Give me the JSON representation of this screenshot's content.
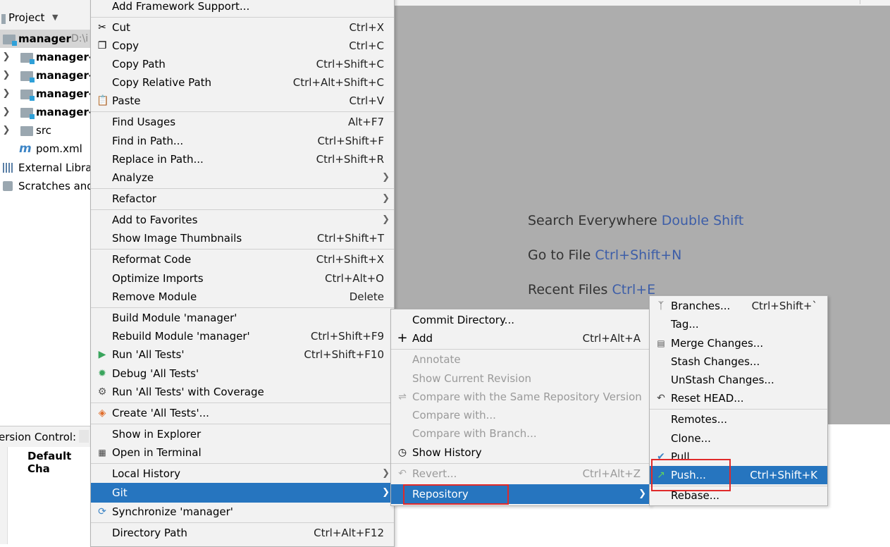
{
  "project": {
    "header": "Project",
    "root": {
      "name": "manager",
      "path": "D:\\i"
    },
    "items": [
      {
        "name": "manager-r",
        "kind": "module"
      },
      {
        "name": "manager-p",
        "kind": "module"
      },
      {
        "name": "manager-s",
        "kind": "module"
      },
      {
        "name": "manager-v",
        "kind": "module"
      },
      {
        "name": "src",
        "kind": "folder"
      },
      {
        "name": "pom.xml",
        "kind": "maven"
      }
    ],
    "external": "External Librar",
    "scratches": "Scratches and"
  },
  "version_control": {
    "label": "ersion Control:",
    "changelist": "Default Cha"
  },
  "editor_hints": [
    {
      "text": "Search Everywhere",
      "key": "Double Shift"
    },
    {
      "text": "Go to File",
      "key": "Ctrl+Shift+N"
    },
    {
      "text": "Recent Files",
      "key": "Ctrl+E"
    }
  ],
  "context_menu": {
    "items": [
      {
        "label": "Add Framework Support...",
        "shortcut": ""
      },
      {
        "label": "Cut",
        "shortcut": "Ctrl+X",
        "icon": "scissors-icon"
      },
      {
        "label": "Copy",
        "shortcut": "Ctrl+C",
        "icon": "copy-icon"
      },
      {
        "label": "Copy Path",
        "shortcut": "Ctrl+Shift+C"
      },
      {
        "label": "Copy Relative Path",
        "shortcut": "Ctrl+Alt+Shift+C"
      },
      {
        "label": "Paste",
        "shortcut": "Ctrl+V",
        "icon": "paste-icon"
      },
      {
        "label": "Find Usages",
        "shortcut": "Alt+F7"
      },
      {
        "label": "Find in Path...",
        "shortcut": "Ctrl+Shift+F"
      },
      {
        "label": "Replace in Path...",
        "shortcut": "Ctrl+Shift+R"
      },
      {
        "label": "Analyze",
        "shortcut": "",
        "submenu": true
      },
      {
        "label": "Refactor",
        "shortcut": "",
        "submenu": true
      },
      {
        "label": "Add to Favorites",
        "shortcut": "",
        "submenu": true
      },
      {
        "label": "Show Image Thumbnails",
        "shortcut": "Ctrl+Shift+T"
      },
      {
        "label": "Reformat Code",
        "shortcut": "Ctrl+Shift+X"
      },
      {
        "label": "Optimize Imports",
        "shortcut": "Ctrl+Alt+O"
      },
      {
        "label": "Remove Module",
        "shortcut": "Delete"
      },
      {
        "label": "Build Module 'manager'",
        "shortcut": ""
      },
      {
        "label": "Rebuild Module 'manager'",
        "shortcut": "Ctrl+Shift+F9"
      },
      {
        "label": "Run 'All Tests'",
        "shortcut": "Ctrl+Shift+F10",
        "icon": "run-icon"
      },
      {
        "label": "Debug 'All Tests'",
        "shortcut": "",
        "icon": "debug-icon"
      },
      {
        "label": "Run 'All Tests' with Coverage",
        "shortcut": "",
        "icon": "coverage-icon"
      },
      {
        "label": "Create 'All Tests'...",
        "shortcut": "",
        "icon": "create-test-icon"
      },
      {
        "label": "Show in Explorer",
        "shortcut": ""
      },
      {
        "label": "Open in Terminal",
        "shortcut": "",
        "icon": "terminal-icon"
      },
      {
        "label": "Local History",
        "shortcut": "",
        "submenu": true
      },
      {
        "label": "Git",
        "shortcut": "",
        "submenu": true,
        "active": true
      },
      {
        "label": "Synchronize 'manager'",
        "shortcut": "",
        "icon": "sync-icon"
      },
      {
        "label": "Directory Path",
        "shortcut": "Ctrl+Alt+F12"
      }
    ]
  },
  "git_menu": {
    "items": [
      {
        "label": "Commit Directory...",
        "shortcut": ""
      },
      {
        "label": "Add",
        "shortcut": "Ctrl+Alt+A",
        "icon": "plus-icon"
      },
      {
        "label": "Annotate",
        "shortcut": "",
        "disabled": true
      },
      {
        "label": "Show Current Revision",
        "shortcut": "",
        "disabled": true
      },
      {
        "label": "Compare with the Same Repository Version",
        "shortcut": "",
        "disabled": true,
        "icon": "compare-icon"
      },
      {
        "label": "Compare with...",
        "shortcut": "",
        "disabled": true
      },
      {
        "label": "Compare with Branch...",
        "shortcut": "",
        "disabled": true
      },
      {
        "label": "Show History",
        "shortcut": "",
        "icon": "clock-icon"
      },
      {
        "label": "Revert...",
        "shortcut": "Ctrl+Alt+Z",
        "disabled": true,
        "icon": "revert-icon"
      },
      {
        "label": "Repository",
        "shortcut": "",
        "submenu": true,
        "active": true
      }
    ]
  },
  "repo_menu": {
    "items": [
      {
        "label": "Branches...",
        "shortcut": "Ctrl+Shift+`",
        "icon": "branch-icon"
      },
      {
        "label": "Tag...",
        "shortcut": ""
      },
      {
        "label": "Merge Changes...",
        "shortcut": "",
        "icon": "merge-icon"
      },
      {
        "label": "Stash Changes...",
        "shortcut": ""
      },
      {
        "label": "UnStash Changes...",
        "shortcut": ""
      },
      {
        "label": "Reset HEAD...",
        "shortcut": "",
        "icon": "reset-icon"
      },
      {
        "label": "Remotes...",
        "shortcut": ""
      },
      {
        "label": "Clone...",
        "shortcut": ""
      },
      {
        "label": "Pull...",
        "shortcut": "",
        "icon": "pull-icon"
      },
      {
        "label": "Push...",
        "shortcut": "Ctrl+Shift+K",
        "icon": "push-icon",
        "active": true
      },
      {
        "label": "Rebase...",
        "shortcut": ""
      }
    ]
  },
  "colors": {
    "accent": "#2675bf",
    "highlight_box": "#e02a2a",
    "editor_bg": "#adadad",
    "hint_key": "#3d5ea8"
  }
}
